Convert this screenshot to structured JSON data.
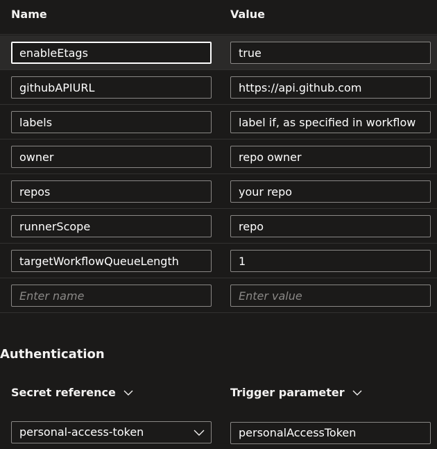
{
  "table": {
    "name_header": "Name",
    "value_header": "Value",
    "rows": [
      {
        "name": "enableEtags",
        "value": "true"
      },
      {
        "name": "githubAPIURL",
        "value": "https://api.github.com"
      },
      {
        "name": "labels",
        "value": "label if, as specified in workflow"
      },
      {
        "name": "owner",
        "value": "repo owner"
      },
      {
        "name": "repos",
        "value": "your repo"
      },
      {
        "name": "runnerScope",
        "value": "repo"
      },
      {
        "name": "targetWorkflowQueueLength",
        "value": "1"
      }
    ],
    "new_row": {
      "name_placeholder": "Enter name",
      "value_placeholder": "Enter value"
    }
  },
  "authentication": {
    "title": "Authentication",
    "secret_reference_label": "Secret reference",
    "trigger_parameter_label": "Trigger parameter",
    "secret_reference_value": "personal-access-token",
    "trigger_parameter_value": "personalAccessToken"
  },
  "icons": {
    "dropdown": "chevron-down-icon"
  },
  "colors": {
    "background": "#1b1a19",
    "border": "#8a8886",
    "text": "#ffffff",
    "placeholder": "#8a8886"
  }
}
